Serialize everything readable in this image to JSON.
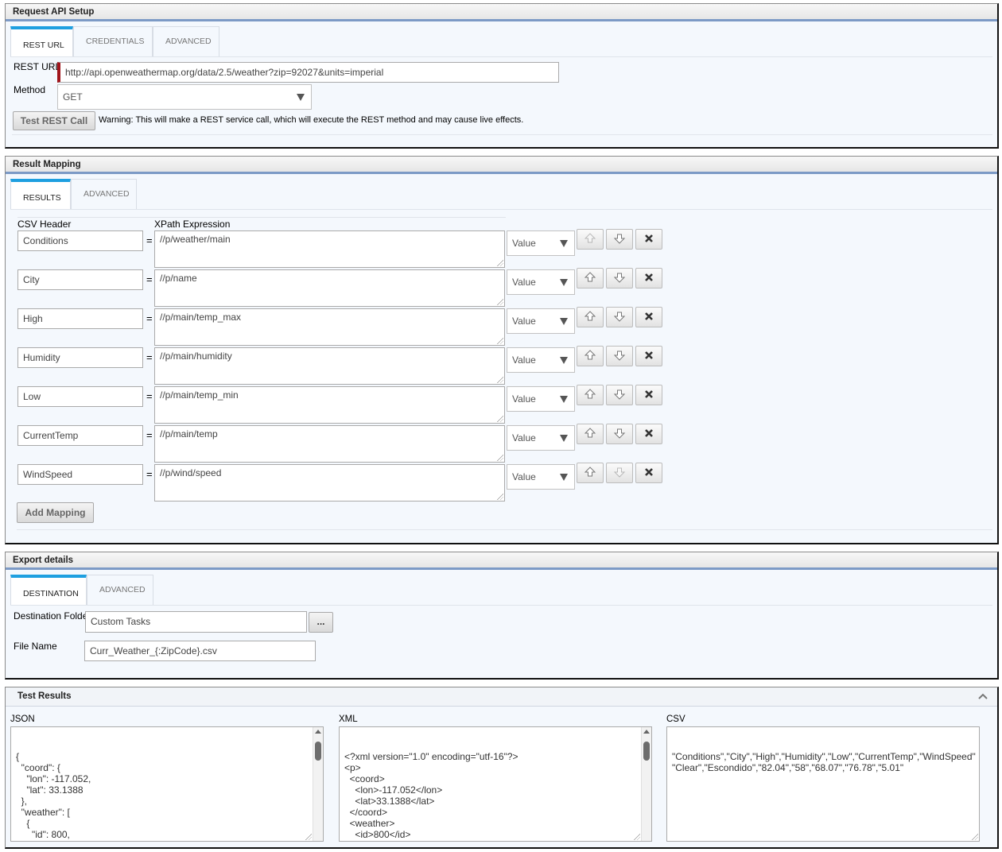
{
  "request_setup": {
    "title": "Request API Setup",
    "tabs": [
      "REST URL",
      "CREDENTIALS",
      "ADVANCED"
    ],
    "rest_url_label": "REST URL",
    "rest_url_value": "http://api.openweathermap.org/data/2.5/weather?zip=92027&units=imperial",
    "method_label": "Method",
    "method_value": "GET",
    "test_button": "Test REST Call",
    "warning": "Warning: This will make a REST service call, which will execute the REST method and may cause live effects."
  },
  "result_mapping": {
    "title": "Result Mapping",
    "tabs": [
      "RESULTS",
      "ADVANCED"
    ],
    "csv_header_label": "CSV Header",
    "xpath_label": "XPath Expression",
    "equals": "=",
    "rows": [
      {
        "header": "Conditions",
        "xpath": "//p/weather/main",
        "type": "Value"
      },
      {
        "header": "City",
        "xpath": "//p/name",
        "type": "Value"
      },
      {
        "header": "High",
        "xpath": "//p/main/temp_max",
        "type": "Value"
      },
      {
        "header": "Humidity",
        "xpath": "//p/main/humidity",
        "type": "Value"
      },
      {
        "header": "Low",
        "xpath": "//p/main/temp_min",
        "type": "Value"
      },
      {
        "header": "CurrentTemp",
        "xpath": "//p/main/temp",
        "type": "Value"
      },
      {
        "header": "WindSpeed",
        "xpath": "//p/wind/speed",
        "type": "Value"
      }
    ],
    "add_button": "Add Mapping"
  },
  "export": {
    "title": "Export details",
    "tabs": [
      "DESTINATION",
      "ADVANCED"
    ],
    "folder_label": "Destination Folder",
    "folder_value": "Custom Tasks",
    "browse_button": "...",
    "file_label": "File Name",
    "file_value": "Curr_Weather_{:ZipCode}.csv"
  },
  "test_results": {
    "title": "Test Results",
    "json_label": "JSON",
    "xml_label": "XML",
    "csv_label": "CSV",
    "json_text": "{\n  \"coord\": {\n    \"lon\": -117.052,\n    \"lat\": 33.1388\n  },\n  \"weather\": [\n    {\n      \"id\": 800,\n      \"main\": \"Clear\",\n      \"description\": \"clear sky\",",
    "xml_text": "<?xml version=\"1.0\" encoding=\"utf-16\"?>\n<p>\n  <coord>\n    <lon>-117.052</lon>\n    <lat>33.1388</lat>\n  </coord>\n  <weather>\n    <id>800</id>\n    <main>Clear</main>\n    <description>clear sky</description>",
    "csv_text": "\"Conditions\",\"City\",\"High\",\"Humidity\",\"Low\",\"CurrentTemp\",\"WindSpeed\"\n\"Clear\",\"Escondido\",\"82.04\",\"58\",\"68.07\",\"76.78\",\"5.01\""
  }
}
